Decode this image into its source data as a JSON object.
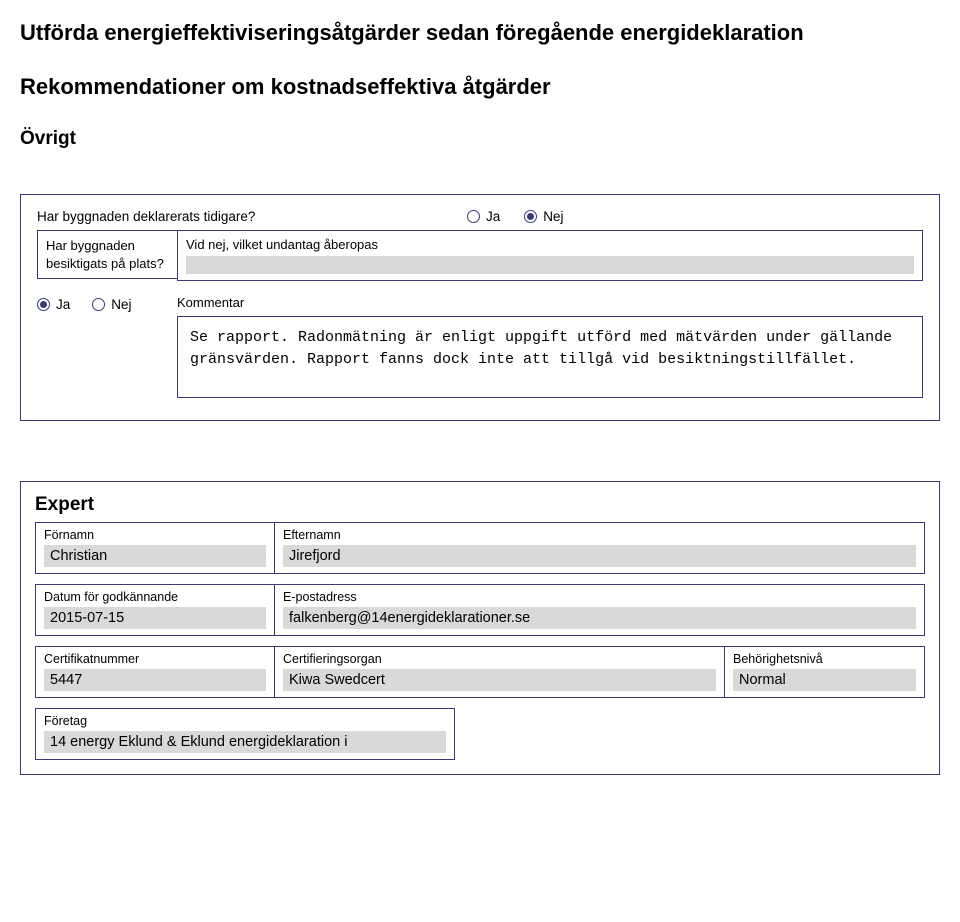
{
  "headings": {
    "h1": "Utförda energieffektiviseringsåtgärder sedan föregående energideklaration",
    "h2": "Rekommendationer om kostnadseffektiva åtgärder"
  },
  "ovrigt": {
    "title": "Övrigt",
    "q1": "Har byggnaden deklarerats tidigare?",
    "ja": "Ja",
    "nej": "Nej",
    "q2_left": "Har byggnaden besiktigats på plats?",
    "q2_right_label": "Vid nej, vilket undantag åberopas",
    "kommentar_label": "Kommentar",
    "kommentar_text": "Se rapport. Radonmätning är enligt uppgift utförd med mätvärden under gällande gränsvärden. Rapport fanns dock inte att tillgå vid besiktningstillfället."
  },
  "expert": {
    "title": "Expert",
    "fornamn_label": "Förnamn",
    "fornamn": "Christian",
    "efternamn_label": "Efternamn",
    "efternamn": "Jirefjord",
    "datum_label": "Datum för godkännande",
    "datum": "2015-07-15",
    "epost_label": "E-postadress",
    "epost": "falkenberg@14energideklarationer.se",
    "certnr_label": "Certifikatnummer",
    "certnr": "5447",
    "certorg_label": "Certifieringsorgan",
    "certorg": "Kiwa Swedcert",
    "behorighet_label": "Behörighetsnivå",
    "behorighet": "Normal",
    "foretag_label": "Företag",
    "foretag": "14 energy Eklund & Eklund energideklaration i"
  }
}
